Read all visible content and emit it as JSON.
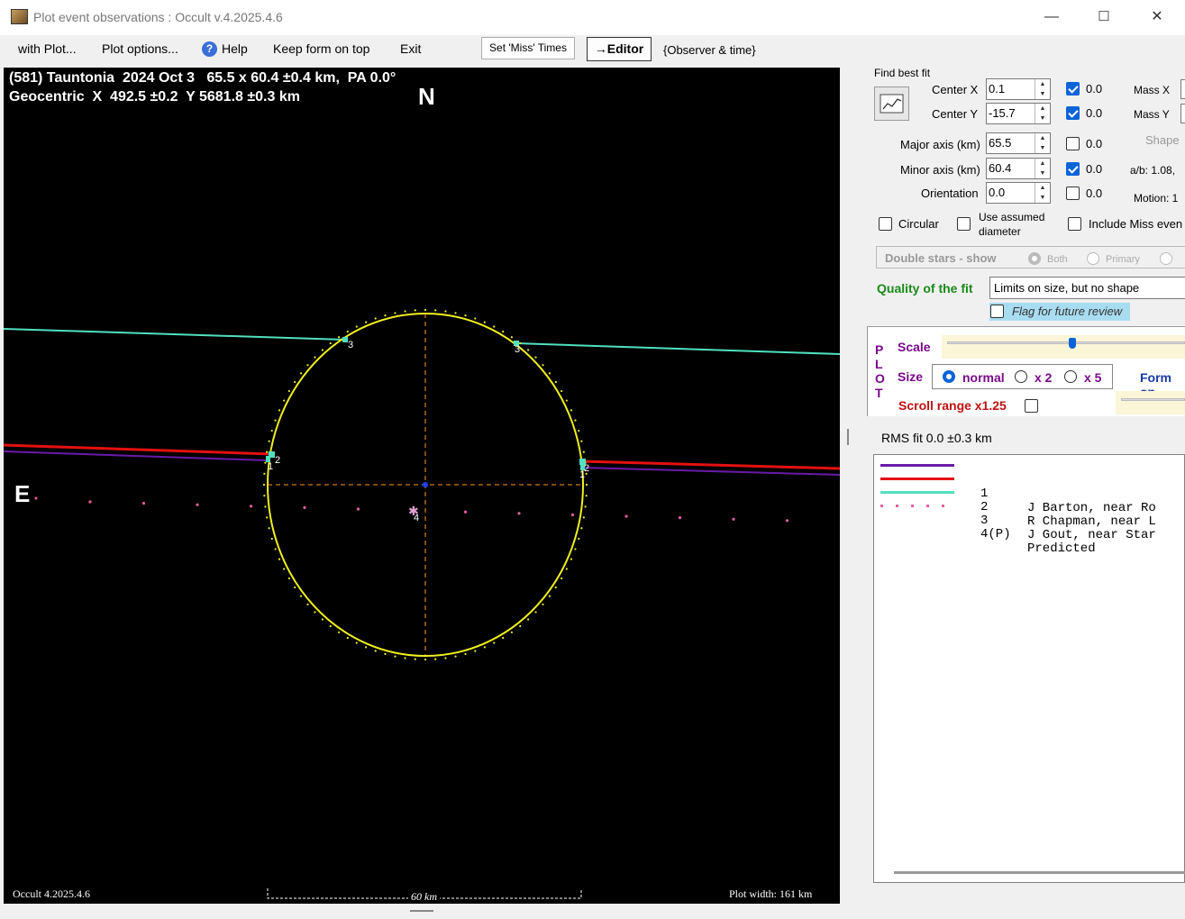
{
  "window": {
    "title": "Plot event observations : Occult v.4.2025.4.6",
    "minimize": "—",
    "maximize": "☐",
    "close": "✕"
  },
  "menu": {
    "with_plot": "with Plot...",
    "plot_options": "Plot options...",
    "help": "Help",
    "keep_form_on_top": "Keep form on top",
    "exit": "Exit",
    "set_miss_times": "Set 'Miss' Times",
    "editor": "→Editor",
    "observer_time": "{Observer & time}"
  },
  "plot": {
    "header_line1": "(581) Tauntonia  2024 Oct 3   65.5 x 60.4 ±0.4 km,  PA 0.0°",
    "header_line2": "Geocentric  X  492.5 ±0.2  Y 5681.8 ±0.3 km",
    "north": "N",
    "east": "E",
    "footer_version": "Occult 4.2025.4.6",
    "scale_label": "60 km",
    "plot_width": "Plot width: 161 km",
    "chord_labels": [
      "1",
      "2",
      "3",
      "4"
    ],
    "colors": {
      "ellipse": "#f0f020",
      "chord1": "#6a1aa8",
      "chord2": "#e41010",
      "chord3": "#50e0c0",
      "predicted": "#e060a0",
      "axes": "#ff9a1a"
    }
  },
  "find_best_fit": {
    "title": "Find best fit",
    "center_x_label": "Center X",
    "center_x": "0.1",
    "center_x_unc": "0.0",
    "center_y_label": "Center Y",
    "center_y": "-15.7",
    "center_y_unc": "0.0",
    "major_label": "Major axis (km)",
    "major": "65.5",
    "major_unc": "0.0",
    "minor_label": "Minor axis (km)",
    "minor": "60.4",
    "minor_unc": "0.0",
    "orient_label": "Orientation",
    "orient": "0.0",
    "orient_unc": "0.0",
    "mass_x": "Mass X",
    "mass_y": "Mass Y",
    "shape": "Shape",
    "ab": "a/b: 1.08,",
    "motion": "Motion: 1",
    "circular": "Circular",
    "use_assumed": "Use assumed",
    "diameter": "diameter",
    "include_miss": "Include Miss even",
    "double_stars": "Double stars - show",
    "both": "Both",
    "primary": "Primary",
    "quality_label": "Quality of the fit",
    "quality_value": "Limits on size, but no shape",
    "flag_review": "Flag for future review"
  },
  "plot_panel": {
    "vertical": "P L O T",
    "scale": "Scale",
    "size": "Size",
    "normal": "normal",
    "x2": "x 2",
    "x5": "x 5",
    "form_opt": "Form op",
    "scroll_range": "Scroll range x1.25"
  },
  "rms": "RMS fit 0.0 ±0.3 km",
  "legend": [
    {
      "num": "1",
      "name": "J Barton, near Ro"
    },
    {
      "num": "2",
      "name": "R Chapman, near L"
    },
    {
      "num": "3",
      "name": "J Gout, near Star"
    },
    {
      "num": "4(P)",
      "name": "Predicted"
    }
  ]
}
